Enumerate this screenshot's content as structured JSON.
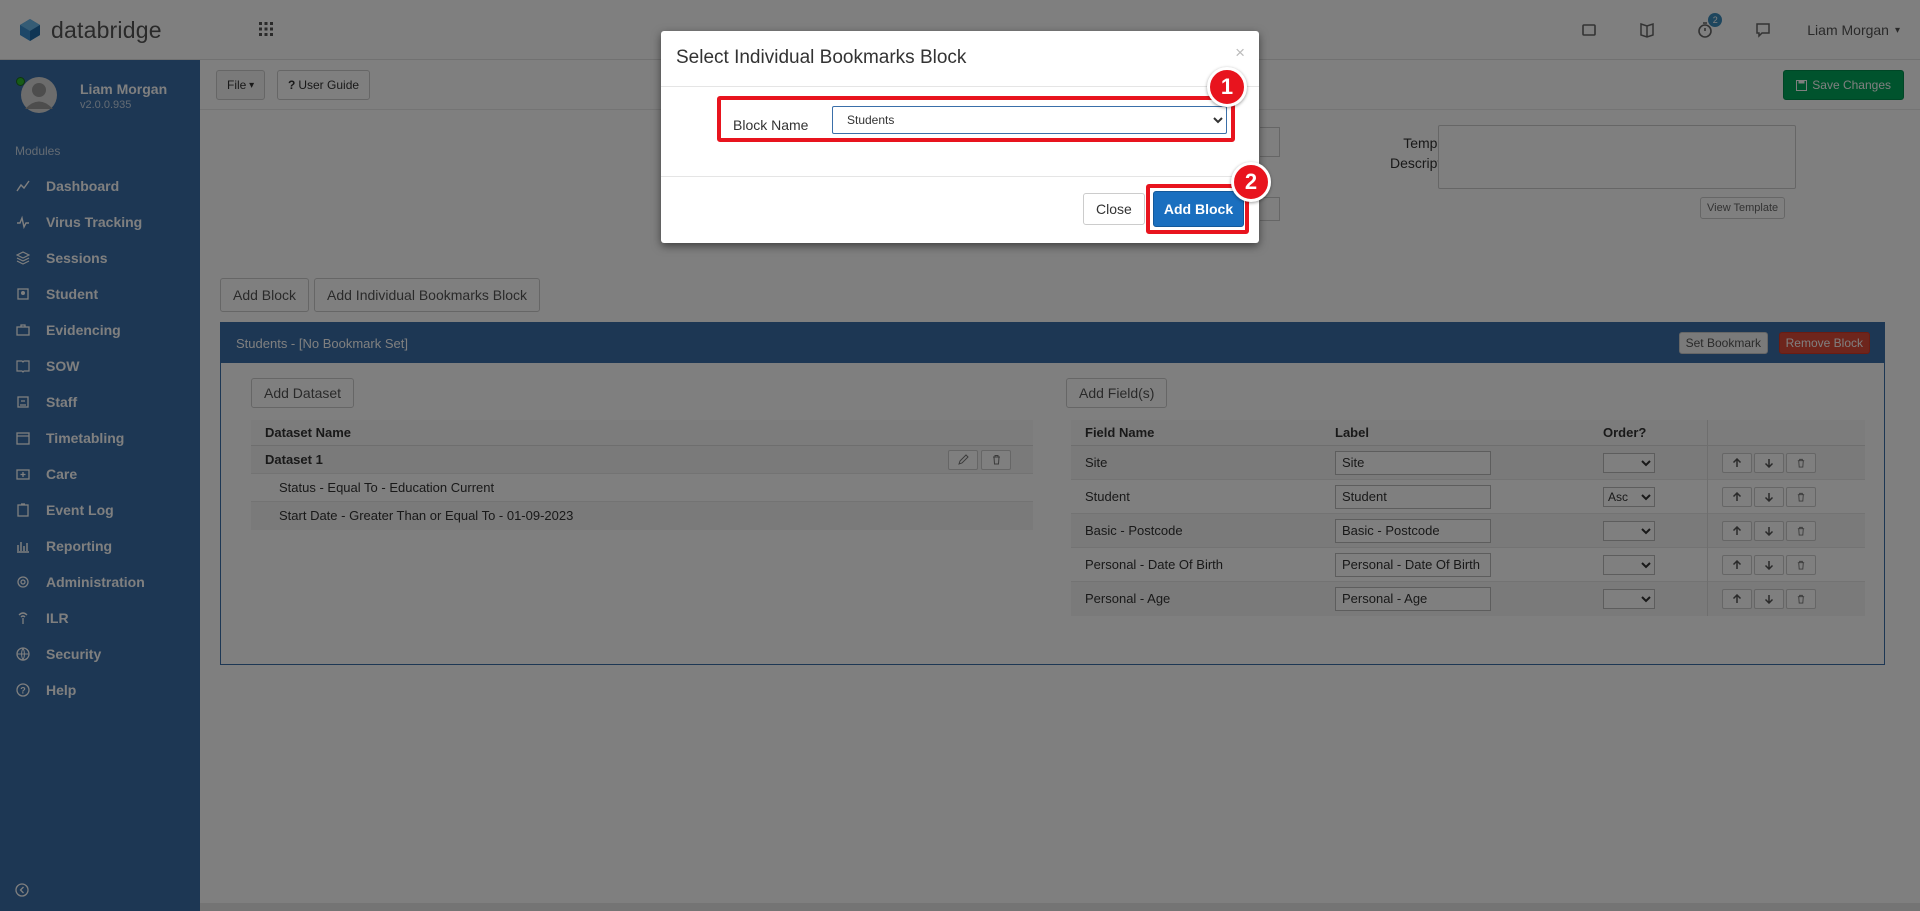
{
  "app": {
    "brand": "databridge"
  },
  "topbar": {
    "notification_count": "2",
    "user_name": "Liam Morgan"
  },
  "sidebar": {
    "profile_name": "Liam Morgan",
    "version": "v2.0.0.935",
    "modules_label": "Modules",
    "items": [
      {
        "label": "Dashboard",
        "icon": "line-chart-icon"
      },
      {
        "label": "Virus Tracking",
        "icon": "heartbeat-icon"
      },
      {
        "label": "Sessions",
        "icon": "layers-icon"
      },
      {
        "label": "Student",
        "icon": "student-icon"
      },
      {
        "label": "Evidencing",
        "icon": "briefcase-icon"
      },
      {
        "label": "SOW",
        "icon": "book-icon"
      },
      {
        "label": "Staff",
        "icon": "staff-icon"
      },
      {
        "label": "Timetabling",
        "icon": "calendar-icon"
      },
      {
        "label": "Care",
        "icon": "care-icon"
      },
      {
        "label": "Event Log",
        "icon": "clipboard-icon"
      },
      {
        "label": "Reporting",
        "icon": "bar-chart-icon"
      },
      {
        "label": "Administration",
        "icon": "gear-icon"
      },
      {
        "label": "ILR",
        "icon": "broadcast-icon"
      },
      {
        "label": "Security",
        "icon": "globe-icon"
      },
      {
        "label": "Help",
        "icon": "question-icon"
      }
    ]
  },
  "toolbar": {
    "file_label": "File",
    "guide_label": "User Guide",
    "save_label": "Save Changes"
  },
  "template": {
    "description_label": "Template Description",
    "view_template_label": "View Template"
  },
  "blocks": {
    "add_block_label": "Add Block",
    "add_individual_label": "Add Individual Bookmarks Block"
  },
  "block": {
    "title": "Students - [No Bookmark Set]",
    "set_bookmark_label": "Set Bookmark",
    "remove_block_label": "Remove Block",
    "add_dataset_label": "Add Dataset",
    "add_fields_label": "Add Field(s)",
    "dataset_header": "Dataset Name",
    "dataset_name": "Dataset 1",
    "conditions": [
      "Status - Equal To - Education Current",
      "Start Date - Greater Than or Equal To - 01-09-2023"
    ],
    "fields_headers": {
      "field": "Field Name",
      "label": "Label",
      "order": "Order?"
    },
    "fields": [
      {
        "name": "Site",
        "label": "Site",
        "order": ""
      },
      {
        "name": "Student",
        "label": "Student",
        "order": "Asc"
      },
      {
        "name": "Basic - Postcode",
        "label": "Basic - Postcode",
        "order": ""
      },
      {
        "name": "Personal - Date Of Birth",
        "label": "Personal - Date Of Birth",
        "order": ""
      },
      {
        "name": "Personal - Age",
        "label": "Personal - Age",
        "order": ""
      }
    ]
  },
  "modal": {
    "title": "Select Individual Bookmarks Block",
    "close_x": "×",
    "block_name_label": "Block Name",
    "block_name_value": "Students",
    "close_label": "Close",
    "add_block_label": "Add Block"
  },
  "annotations": {
    "step1": "1",
    "step2": "2",
    "color": "#e8141e"
  }
}
